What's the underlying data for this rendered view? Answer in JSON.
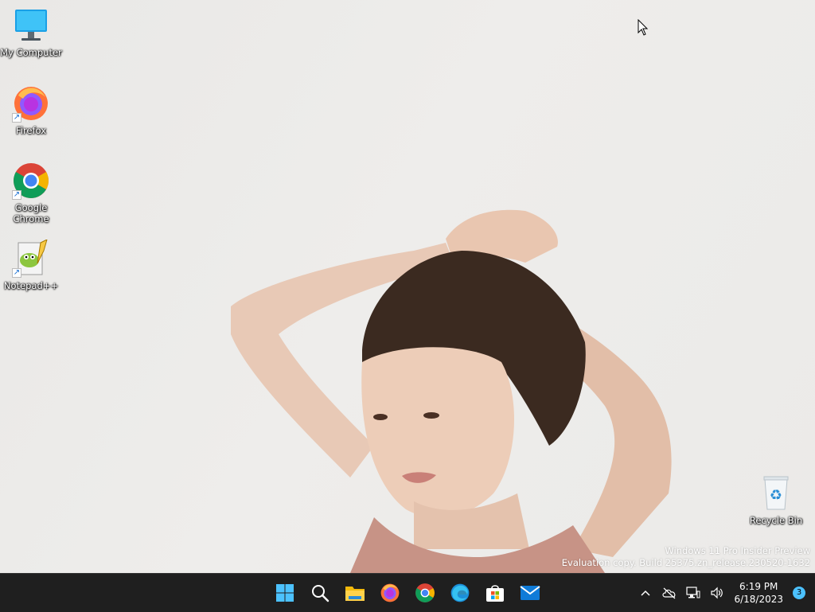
{
  "desktop": {
    "icons": [
      {
        "label": "My Computer"
      },
      {
        "label": "Firefox"
      },
      {
        "label": "Google Chrome"
      },
      {
        "label": "Notepad++"
      },
      {
        "label": "Recycle Bin"
      }
    ],
    "watermark": {
      "line1": "Windows 11 Pro Insider Preview",
      "line2": "Evaluation copy. Build 25375.zn_release.230520-1632"
    }
  },
  "taskbar": {
    "apps": [
      "start-icon",
      "search-icon",
      "file-explorer-icon",
      "firefox-icon",
      "chrome-icon",
      "edge-icon",
      "microsoft-store-icon",
      "mail-icon"
    ],
    "tray": {
      "time": "6:19 PM",
      "date": "6/18/2023",
      "notification_count": "3"
    }
  },
  "colors": {
    "taskbar_bg": "#1f1f1f",
    "accent": "#4cc2ff"
  }
}
